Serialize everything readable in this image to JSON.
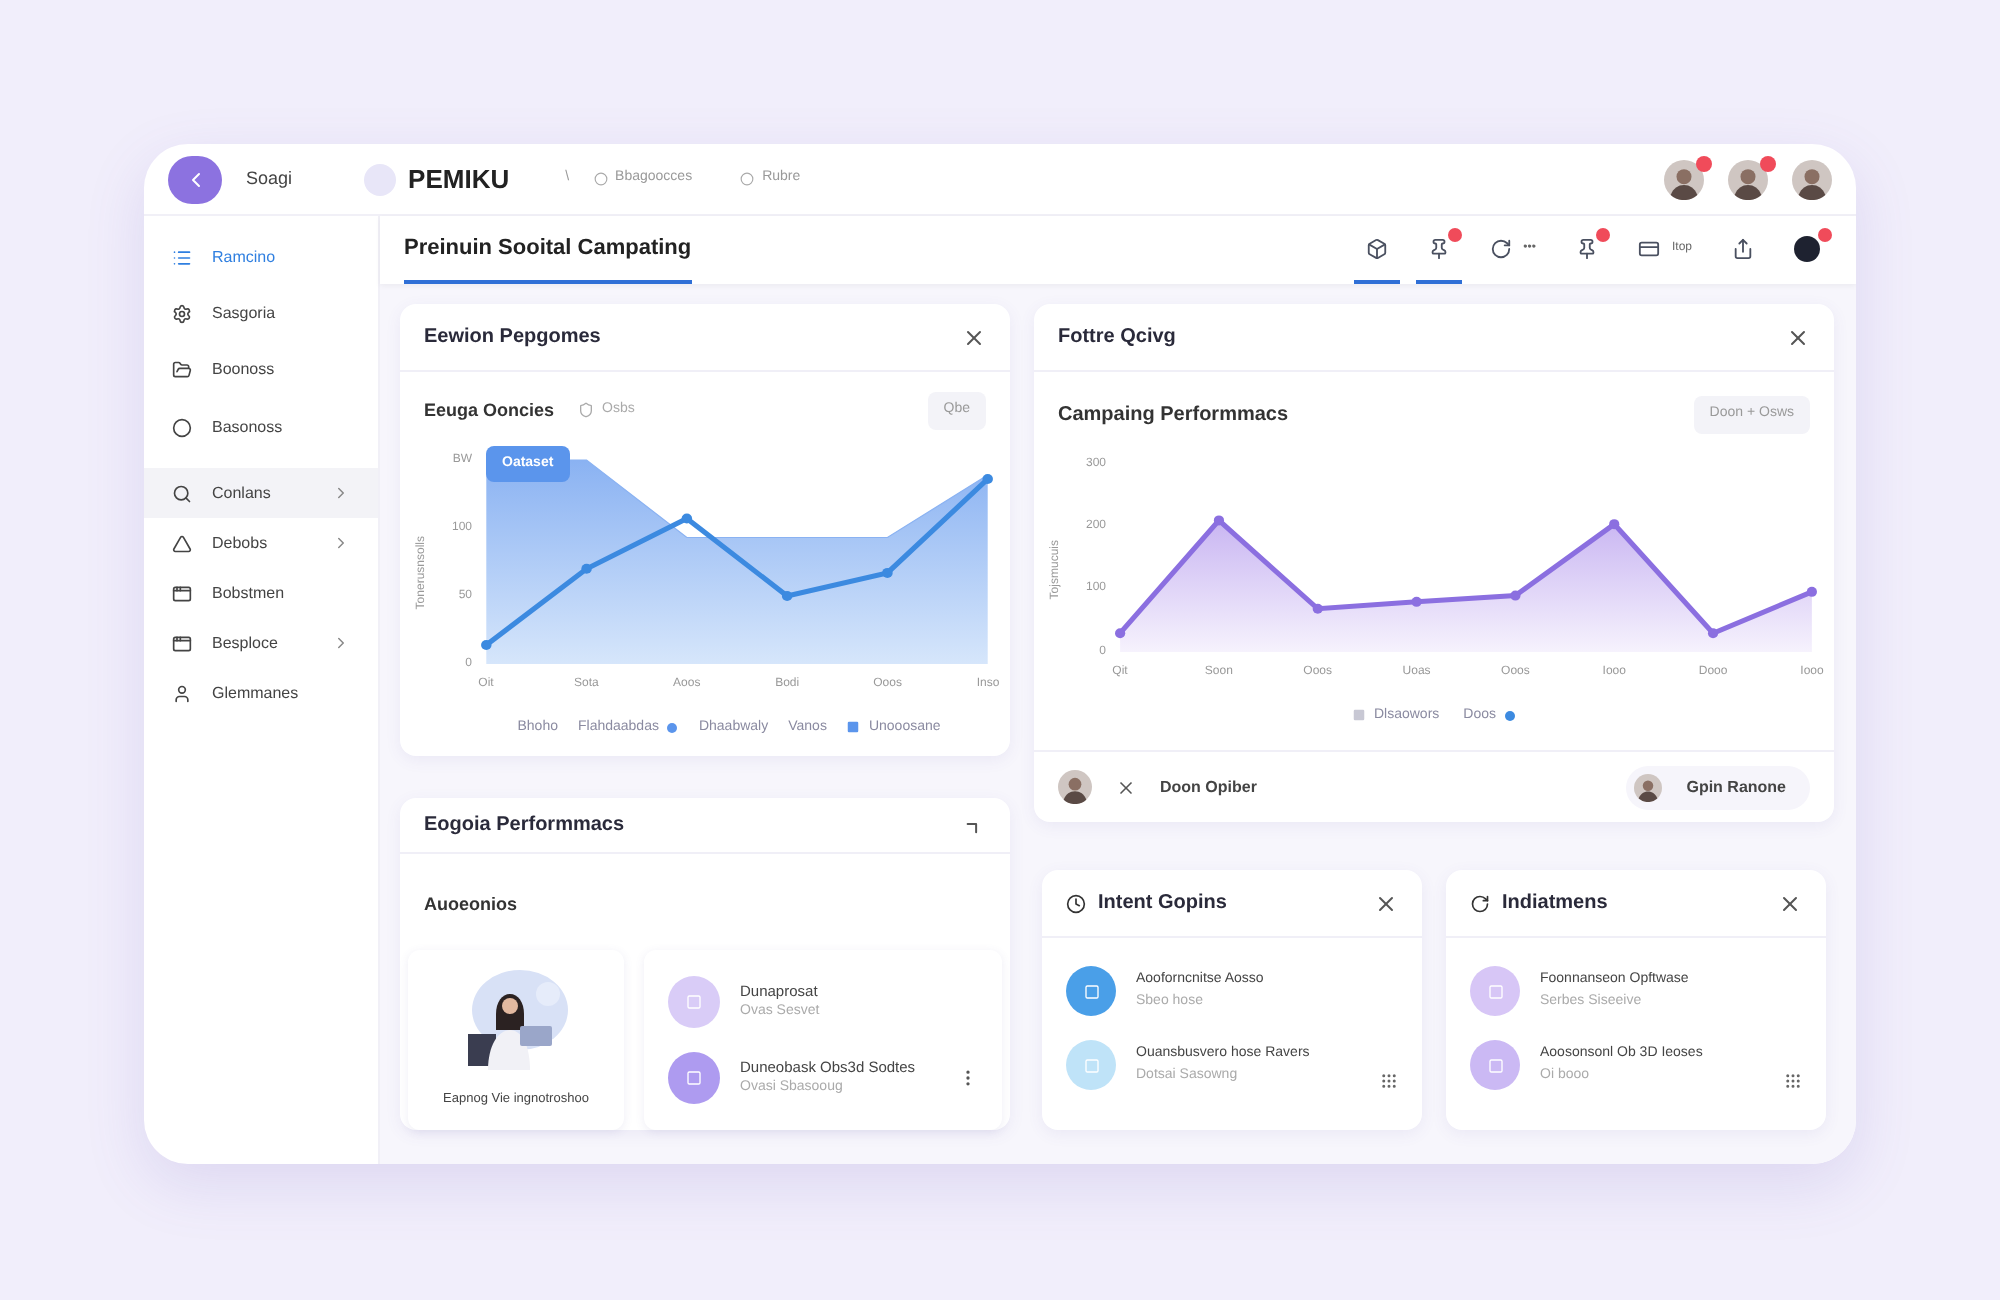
{
  "topbar": {
    "back_label": "Soagi",
    "brand": "PEMIKU",
    "separator": "\\",
    "links": [
      "Bbagoocces",
      "Rubre"
    ],
    "avatars": [
      {
        "badge": true
      },
      {
        "badge": true
      },
      {
        "badge": false
      }
    ]
  },
  "page_title": "Preinuin Sooital Campating",
  "toolbar": [
    {
      "kind": "box",
      "selected": true,
      "badge": false
    },
    {
      "kind": "pin",
      "selected": true,
      "badge": true
    },
    {
      "kind": "refresh",
      "label": "•••",
      "selected": false,
      "badge": false
    },
    {
      "kind": "pin",
      "selected": false,
      "badge": true
    },
    {
      "kind": "card",
      "label": "Itop",
      "selected": false,
      "badge": false
    },
    {
      "kind": "share",
      "selected": false,
      "badge": false
    },
    {
      "kind": "dark",
      "selected": false,
      "badge": true
    }
  ],
  "sidebar": {
    "items": [
      {
        "label": "Ramcino",
        "accent": true,
        "selected": false,
        "chevron": false
      },
      {
        "label": "Sasgoria",
        "accent": false,
        "selected": false,
        "chevron": false
      },
      {
        "label": "Boonoss",
        "accent": false,
        "selected": false,
        "chevron": false
      },
      {
        "label": "Basonoss",
        "accent": false,
        "selected": false,
        "chevron": false
      },
      {
        "label": "Conlans",
        "accent": false,
        "selected": true,
        "chevron": true
      },
      {
        "label": "Debobs",
        "accent": false,
        "selected": false,
        "chevron": true
      },
      {
        "label": "Bobstmen",
        "accent": false,
        "selected": false,
        "chevron": false
      },
      {
        "label": "Besploce",
        "accent": false,
        "selected": false,
        "chevron": true
      },
      {
        "label": "Glemmanes",
        "accent": false,
        "selected": false,
        "chevron": false
      }
    ]
  },
  "reach_card": {
    "title": "Eewion Pepgomes",
    "subtitle": "Eeuga Ooncies",
    "tag": "Osbs",
    "button": "Qbe",
    "tooltip": "Oataset",
    "chart_data": {
      "type": "area",
      "ylabel": "Tonerusnsolls",
      "categories": [
        "Oit",
        "Sota",
        "Aoos",
        "Bodi",
        "Ooos",
        "Inso"
      ],
      "ylim": [
        0,
        150
      ],
      "yticks": [
        {
          "value": 150,
          "label": "BW"
        },
        100,
        50,
        0
      ],
      "series": [
        {
          "color": "#8ab2f2",
          "values": [
            150,
            150,
            93,
            93,
            93,
            139
          ]
        },
        {
          "type": "line",
          "marker": true,
          "color": "#3c8ae0",
          "values": [
            14,
            70,
            107,
            50,
            67,
            136
          ]
        }
      ]
    },
    "legend": [
      {
        "label": "Bhoho",
        "kind": "text"
      },
      {
        "label": "Flahdaabdas",
        "kind": "dot"
      },
      {
        "label": "Dhaabwaly",
        "kind": "text"
      },
      {
        "label": "Vanos",
        "kind": "text"
      },
      {
        "label": "Unooosane",
        "kind": "square"
      }
    ]
  },
  "campaign_card": {
    "title": "Fottre Qcivg",
    "subtitle": "Campaing Performmacs",
    "button": "Doon + Osws",
    "chart_data": {
      "type": "area",
      "ylabel": "Tojsmucuis",
      "categories": [
        "Qit",
        "Soon",
        "Ooos",
        "Uoas",
        "Ooos",
        "Iooo",
        "Dooo",
        "Iooo"
      ],
      "ylim": [
        0,
        300
      ],
      "yticks": [
        300,
        200,
        100,
        0
      ],
      "series": [
        {
          "marker": true,
          "color": "#8b6fe0",
          "values": [
            30,
            210,
            69,
            80,
            90,
            204,
            30,
            96
          ]
        }
      ]
    },
    "legend": [
      {
        "label": "Dlsaowors",
        "kind": "square"
      },
      {
        "label": "Doos",
        "kind": "dot"
      }
    ],
    "footer_name": "Doon Opiber",
    "footer_pill": "Gpin Ranone"
  },
  "performance_card": {
    "title": "Eogoia Performmacs",
    "section": "Auoeonios",
    "picture_caption": "Eapnog Vie ingnotroshoo",
    "rows": [
      {
        "title": "Dunaprosat",
        "sub": "Ovas Sesvet",
        "color": "#d9ccf7"
      },
      {
        "title": "Duneobask Obs3d Sodtes",
        "sub": "Ovasi Sbasooug",
        "color": "#ae9bf0"
      }
    ]
  },
  "small_cards": [
    {
      "title": "Intent Gopins",
      "rows": [
        {
          "title": "Aooforncnitse Aosso",
          "sub": "Sbeo hose",
          "color": "#4a9fe8"
        },
        {
          "title": "Ouansbusvero hose Ravers",
          "sub": "Dotsai Sasowng",
          "color": "#bfe3f8"
        }
      ]
    },
    {
      "title": "Indiatmens",
      "rows": [
        {
          "title": "Foonnanseon Opftwase",
          "sub": "Serbes Siseeive",
          "color": "#d7c6f6"
        },
        {
          "title": "Aoosonsonl Ob 3D Ieoses",
          "sub": "Oi booo",
          "color": "#cbb9f4"
        }
      ]
    }
  ]
}
